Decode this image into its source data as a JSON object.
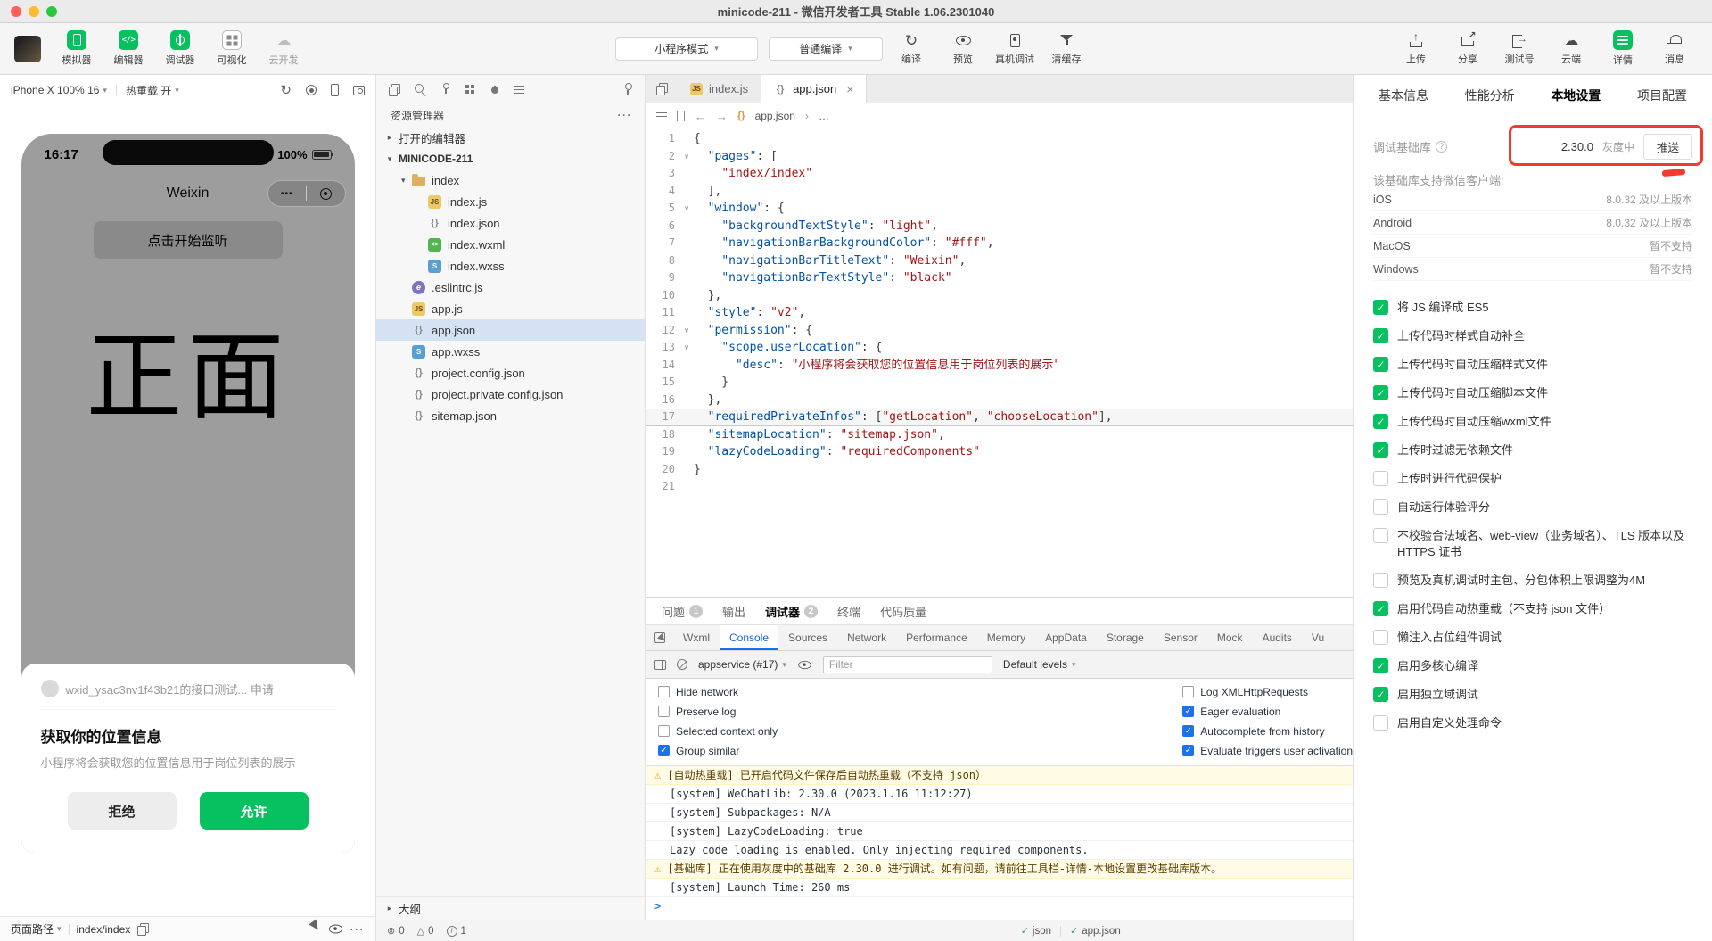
{
  "titlebar": {
    "title": "minicode-211 - 微信开发者工具 Stable 1.06.2301040"
  },
  "toolbar": {
    "buttons_left": [
      {
        "label": "模拟器"
      },
      {
        "label": "编辑器"
      },
      {
        "label": "调试器"
      },
      {
        "label": "可视化"
      },
      {
        "label": "云开发"
      }
    ],
    "mode_select": "小程序模式",
    "compile_select": "普通编译",
    "actions": [
      {
        "label": "编译"
      },
      {
        "label": "预览"
      },
      {
        "label": "真机调试"
      },
      {
        "label": "清缓存"
      }
    ],
    "buttons_right": [
      {
        "label": "上传"
      },
      {
        "label": "分享"
      },
      {
        "label": "测试号"
      },
      {
        "label": "云端"
      },
      {
        "label": "详情"
      },
      {
        "label": "消息"
      }
    ]
  },
  "simulator": {
    "device_select": "iPhone X 100% 16",
    "hot_reload": "热重载 开",
    "phone": {
      "time": "16:17",
      "battery": "100%",
      "nav_title": "Weixin",
      "listen_button": "点击开始监听",
      "big_text": "正面",
      "dialog": {
        "request": "wxid_ysac3nv1f43b21的接口测试... 申请",
        "title": "获取你的位置信息",
        "desc": "小程序将会获取您的位置信息用于岗位列表的展示",
        "deny": "拒绝",
        "allow": "允许"
      }
    },
    "bottombar": {
      "page_path_label": "页面路径",
      "page_path": "index/index"
    }
  },
  "explorer": {
    "title": "资源管理器",
    "open_editors": "打开的编辑器",
    "project_name": "MINICODE-211",
    "outline": "大纲",
    "tree": [
      {
        "name": "index",
        "type": "folder",
        "depth": 1
      },
      {
        "name": "index.js",
        "type": "js",
        "depth": 2
      },
      {
        "name": "index.json",
        "type": "json",
        "depth": 2
      },
      {
        "name": "index.wxml",
        "type": "wxml",
        "depth": 2
      },
      {
        "name": "index.wxss",
        "type": "wxss",
        "depth": 2
      },
      {
        "name": ".eslintrc.js",
        "type": "eslint",
        "depth": 1
      },
      {
        "name": "app.js",
        "type": "js",
        "depth": 1
      },
      {
        "name": "app.json",
        "type": "json",
        "depth": 1,
        "selected": true
      },
      {
        "name": "app.wxss",
        "type": "wxss",
        "depth": 1
      },
      {
        "name": "project.config.json",
        "type": "json",
        "depth": 1
      },
      {
        "name": "project.private.config.json",
        "type": "json",
        "depth": 1
      },
      {
        "name": "sitemap.json",
        "type": "json",
        "depth": 1
      }
    ]
  },
  "editor": {
    "tabs": [
      {
        "label": "index.js"
      },
      {
        "label": "app.json"
      }
    ],
    "breadcrumb_file": "app.json",
    "breadcrumb_more": "…",
    "lines": [
      {
        "n": 1,
        "t": [
          [
            "p",
            "{"
          ]
        ]
      },
      {
        "n": 2,
        "fold": true,
        "t": [
          [
            "p",
            "  "
          ],
          [
            "k",
            "\"pages\""
          ],
          [
            "p",
            ": ["
          ]
        ]
      },
      {
        "n": 3,
        "t": [
          [
            "p",
            "    "
          ],
          [
            "s",
            "\"index/index\""
          ]
        ]
      },
      {
        "n": 4,
        "t": [
          [
            "p",
            "  ],"
          ]
        ]
      },
      {
        "n": 5,
        "fold": true,
        "t": [
          [
            "p",
            "  "
          ],
          [
            "k",
            "\"window\""
          ],
          [
            "p",
            ": {"
          ]
        ]
      },
      {
        "n": 6,
        "t": [
          [
            "p",
            "    "
          ],
          [
            "k",
            "\"backgroundTextStyle\""
          ],
          [
            "p",
            ": "
          ],
          [
            "s",
            "\"light\""
          ],
          [
            "p",
            ","
          ]
        ]
      },
      {
        "n": 7,
        "t": [
          [
            "p",
            "    "
          ],
          [
            "k",
            "\"navigationBarBackgroundColor\""
          ],
          [
            "p",
            ": "
          ],
          [
            "s",
            "\"#fff\""
          ],
          [
            "p",
            ","
          ]
        ]
      },
      {
        "n": 8,
        "t": [
          [
            "p",
            "    "
          ],
          [
            "k",
            "\"navigationBarTitleText\""
          ],
          [
            "p",
            ": "
          ],
          [
            "s",
            "\"Weixin\""
          ],
          [
            "p",
            ","
          ]
        ]
      },
      {
        "n": 9,
        "t": [
          [
            "p",
            "    "
          ],
          [
            "k",
            "\"navigationBarTextStyle\""
          ],
          [
            "p",
            ": "
          ],
          [
            "s",
            "\"black\""
          ]
        ]
      },
      {
        "n": 10,
        "t": [
          [
            "p",
            "  },"
          ]
        ]
      },
      {
        "n": 11,
        "t": [
          [
            "p",
            "  "
          ],
          [
            "k",
            "\"style\""
          ],
          [
            "p",
            ": "
          ],
          [
            "s",
            "\"v2\""
          ],
          [
            "p",
            ","
          ]
        ]
      },
      {
        "n": 12,
        "fold": true,
        "t": [
          [
            "p",
            "  "
          ],
          [
            "k",
            "\"permission\""
          ],
          [
            "p",
            ": {"
          ]
        ]
      },
      {
        "n": 13,
        "fold": true,
        "t": [
          [
            "p",
            "    "
          ],
          [
            "k",
            "\"scope.userLocation\""
          ],
          [
            "p",
            ": {"
          ]
        ]
      },
      {
        "n": 14,
        "t": [
          [
            "p",
            "      "
          ],
          [
            "k",
            "\"desc\""
          ],
          [
            "p",
            ": "
          ],
          [
            "s",
            "\"小程序将会获取您的位置信息用于岗位列表的展示\""
          ]
        ]
      },
      {
        "n": 15,
        "t": [
          [
            "p",
            "    }"
          ]
        ]
      },
      {
        "n": 16,
        "t": [
          [
            "p",
            "  },"
          ]
        ]
      },
      {
        "n": 17,
        "active": true,
        "t": [
          [
            "p",
            "  "
          ],
          [
            "k",
            "\"requiredPrivateInfos\""
          ],
          [
            "p",
            ": ["
          ],
          [
            "s",
            "\"getLocation\""
          ],
          [
            "p",
            ", "
          ],
          [
            "s",
            "\"chooseLocation\""
          ],
          [
            "p",
            "],"
          ]
        ]
      },
      {
        "n": 18,
        "t": [
          [
            "p",
            "  "
          ],
          [
            "k",
            "\"sitemapLocation\""
          ],
          [
            "p",
            ": "
          ],
          [
            "s",
            "\"sitemap.json\""
          ],
          [
            "p",
            ","
          ]
        ]
      },
      {
        "n": 19,
        "t": [
          [
            "p",
            "  "
          ],
          [
            "k",
            "\"lazyCodeLoading\""
          ],
          [
            "p",
            ": "
          ],
          [
            "s",
            "\"requiredComponents\""
          ]
        ]
      },
      {
        "n": 20,
        "t": [
          [
            "p",
            "}"
          ]
        ]
      },
      {
        "n": 21,
        "t": []
      }
    ]
  },
  "debug": {
    "panel_tabs": [
      {
        "label": "问题",
        "badge": "1"
      },
      {
        "label": "输出"
      },
      {
        "label": "调试器",
        "badge": "2",
        "active": true
      },
      {
        "label": "终端"
      },
      {
        "label": "代码质量"
      }
    ],
    "devtools_tabs": [
      "Wxml",
      "Console",
      "Sources",
      "Network",
      "Performance",
      "Memory",
      "AppData",
      "Storage",
      "Sensor",
      "Mock",
      "Audits",
      "Vu"
    ],
    "active_devtools_tab": "Console",
    "context_select": "appservice (#17)",
    "filter_placeholder": "Filter",
    "levels_select": "Default levels",
    "checks_left": [
      {
        "label": "Hide network",
        "checked": false
      },
      {
        "label": "Preserve log",
        "checked": false
      },
      {
        "label": "Selected context only",
        "checked": false
      },
      {
        "label": "Group similar",
        "checked": true
      }
    ],
    "checks_right": [
      {
        "label": "Log XMLHttpRequests",
        "checked": false
      },
      {
        "label": "Eager evaluation",
        "checked": true
      },
      {
        "label": "Autocomplete from history",
        "checked": true
      },
      {
        "label": "Evaluate triggers user activation",
        "checked": true
      }
    ],
    "messages": [
      {
        "type": "warning",
        "text": "[自动热重载] 已开启代码文件保存后自动热重载（不支持 json）"
      },
      {
        "type": "log",
        "text": "[system] WeChatLib: 2.30.0 (2023.1.16 11:12:27)"
      },
      {
        "type": "log",
        "text": "[system] Subpackages: N/A"
      },
      {
        "type": "log",
        "text": "[system] LazyCodeLoading: true"
      },
      {
        "type": "log",
        "text": "Lazy code loading is enabled. Only injecting required components."
      },
      {
        "type": "warning",
        "text": "[基础库] 正在使用灰度中的基础库 2.30.0 进行调试。如有问题，请前往工具栏-详情-本地设置更改基础库版本。"
      },
      {
        "type": "log",
        "text": "[system] Launch Time: 260 ms"
      }
    ]
  },
  "statusbar": {
    "errors": "0",
    "warnings": "0",
    "infos": "1",
    "mode": "json",
    "file": "app.json"
  },
  "details": {
    "tabs": [
      "基本信息",
      "性能分析",
      "本地设置",
      "项目配置"
    ],
    "active_tab": "本地设置",
    "lib_label": "调试基础库",
    "lib_version": "2.30.0",
    "lib_channel": "灰度中",
    "push_button": "推送",
    "support_title": "该基础库支持微信客户端:",
    "support_rows": [
      {
        "platform": "iOS",
        "version": "8.0.32 及以上版本"
      },
      {
        "platform": "Android",
        "version": "8.0.32 及以上版本"
      },
      {
        "platform": "MacOS",
        "version": "暂不支持"
      },
      {
        "platform": "Windows",
        "version": "暂不支持"
      }
    ],
    "options": [
      {
        "label": "将 JS 编译成 ES5",
        "checked": true
      },
      {
        "label": "上传代码时样式自动补全",
        "checked": true
      },
      {
        "label": "上传代码时自动压缩样式文件",
        "checked": true
      },
      {
        "label": "上传代码时自动压缩脚本文件",
        "checked": true
      },
      {
        "label": "上传代码时自动压缩wxml文件",
        "checked": true
      },
      {
        "label": "上传时过滤无依赖文件",
        "checked": true
      },
      {
        "label": "上传时进行代码保护",
        "checked": false
      },
      {
        "label": "自动运行体验评分",
        "checked": false
      },
      {
        "label": "不校验合法域名、web-view（业务域名）、TLS 版本以及 HTTPS 证书",
        "checked": false
      },
      {
        "label": "预览及真机调试时主包、分包体积上限调整为4M",
        "checked": false
      },
      {
        "label": "启用代码自动热重载（不支持 json 文件）",
        "checked": true
      },
      {
        "label": "懒注入占位组件调试",
        "checked": false
      },
      {
        "label": "启用多核心编译",
        "checked": true
      },
      {
        "label": "启用独立域调试",
        "checked": true
      },
      {
        "label": "启用自定义处理命令",
        "checked": false
      }
    ]
  }
}
